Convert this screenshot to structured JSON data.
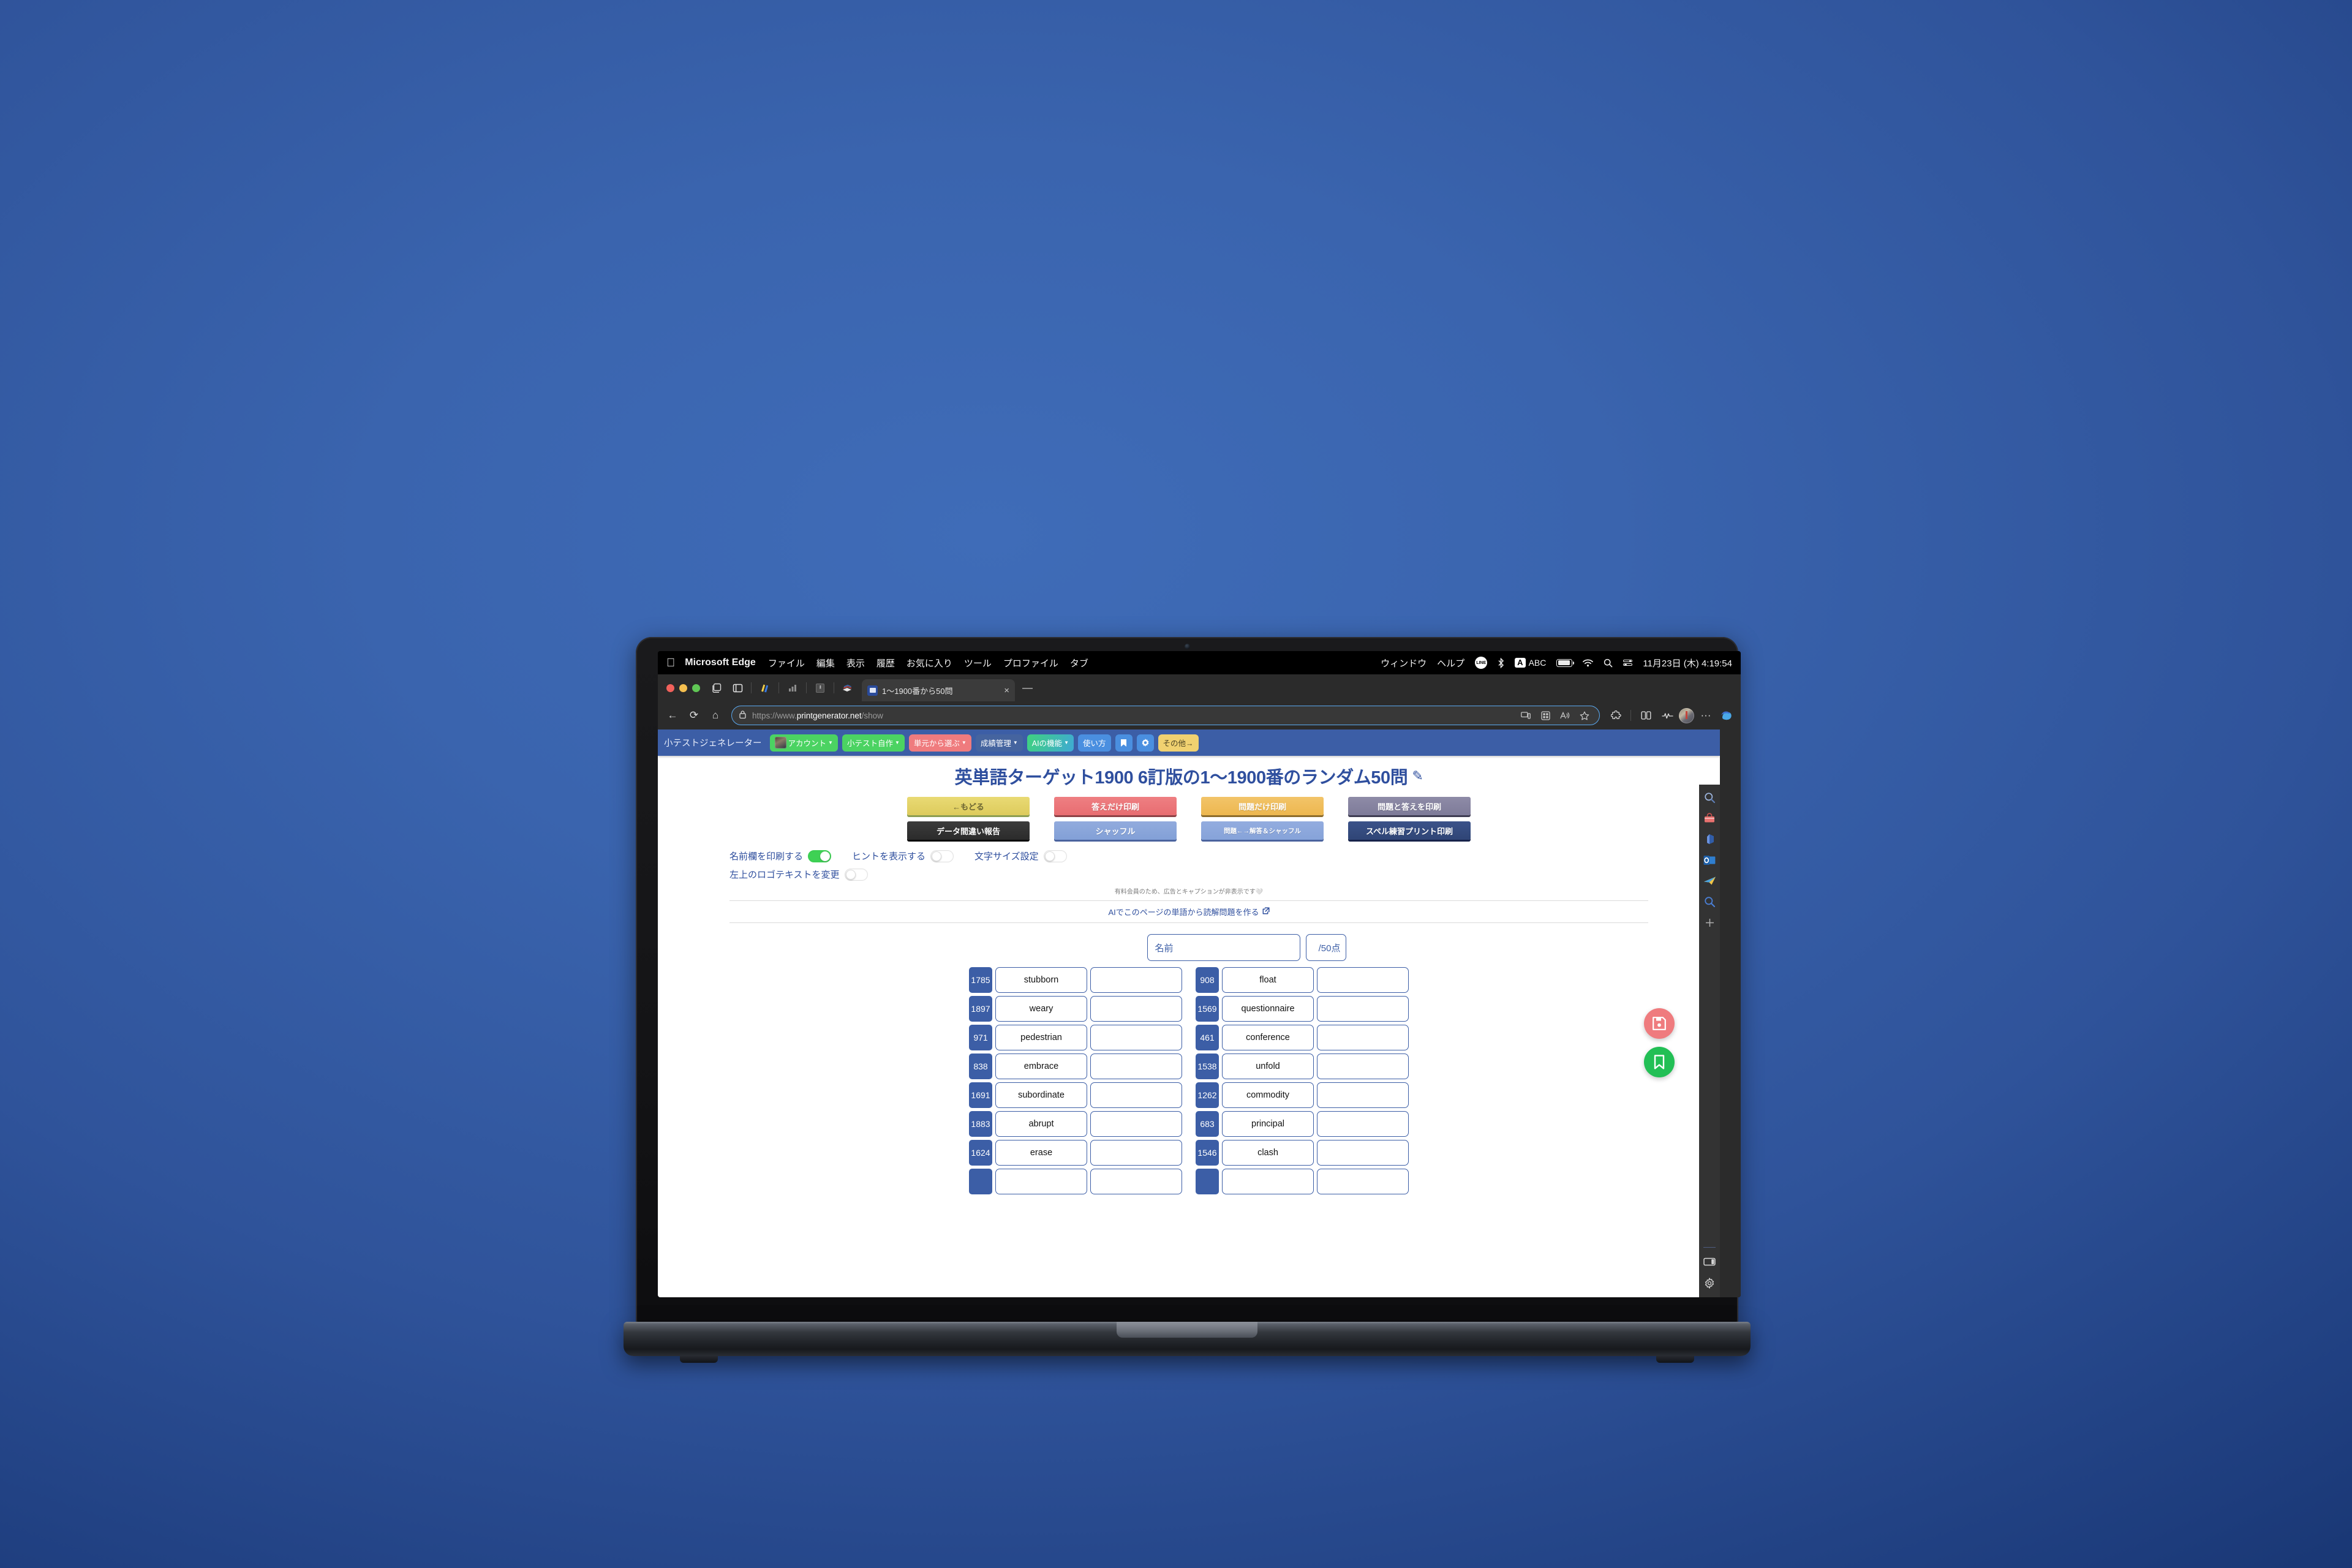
{
  "os": {
    "menubar": {
      "apple_icon": "apple-logo",
      "app_name": "Microsoft Edge",
      "menus": [
        "ファイル",
        "編集",
        "表示",
        "履歴",
        "お気に入り",
        "ツール",
        "プロファイル",
        "タブ"
      ],
      "right_menus": [
        "ウィンドウ",
        "ヘルプ"
      ],
      "status_icons": [
        "line-icon",
        "bluetooth-icon",
        "input-source-abc",
        "battery-icon",
        "wifi-icon",
        "spotlight-search-icon",
        "control-center-icon"
      ],
      "input_source_key": "A",
      "input_source_label": "ABC",
      "clock": "11月23日 (木)  4:19:54"
    }
  },
  "browser": {
    "tabstrip": {
      "traffic_lights": [
        "close",
        "minimize",
        "zoom"
      ],
      "left_icons": [
        "tab-groups-icon",
        "sidebar-toggle-icon",
        "pen-highlighter-icon",
        "bar-chart-icon",
        "reading-list-icon",
        "books-icon"
      ],
      "tab": {
        "favicon": "printgenerator-favicon",
        "title": "1〜1900番から50問",
        "close": "×"
      },
      "new_tab": "—"
    },
    "toolbar": {
      "back": "←",
      "refresh": "⟳",
      "home": "⌂",
      "lock_icon": "lock-icon",
      "url_scheme": "https://www.",
      "url_domain": "printgenerator.net",
      "url_path": "/show",
      "omnibox_icons": [
        "cast-to-device-icon",
        "collections-icon",
        "read-aloud-icon",
        "favorite-star-icon"
      ],
      "right_icons": [
        "extensions-puzzle-icon",
        "split-screen-icon",
        "browser-essentials-icon",
        "profile-avatar",
        "more-options-icon",
        "copilot-icon"
      ]
    },
    "edge_sidebar": {
      "icons": [
        "search-icon",
        "shopping-bag-icon",
        "office-icon",
        "outlook-icon",
        "telegram-plane-icon",
        "discover-search-icon",
        "add-sidebar-icon"
      ],
      "bottom_icons": [
        "sidebar-panel-icon",
        "sidebar-settings-gear-icon"
      ]
    }
  },
  "site": {
    "brand": "小テストジェネレーター",
    "nav_items": [
      {
        "label": "アカウント",
        "caret": "▼",
        "style": "np-green",
        "avatar": true
      },
      {
        "label": "小テスト自作",
        "caret": "▼",
        "style": "np-green",
        "avatar": false
      },
      {
        "label": "単元から選ぶ",
        "caret": "▼",
        "style": "np-red",
        "avatar": false
      },
      {
        "label": "成績管理",
        "caret": "▼",
        "style": "np-dim",
        "avatar": false
      },
      {
        "label": "AIの機能",
        "caret": "▼",
        "style": "np-teal",
        "avatar": false
      },
      {
        "label": "使い方",
        "caret": "",
        "style": "np-blue",
        "avatar": false
      }
    ],
    "nav_icon_buttons": [
      {
        "icon": "bookmark-icon",
        "glyph": "🔖"
      },
      {
        "icon": "gear-icon",
        "glyph": "⚙"
      }
    ],
    "nav_more": {
      "label": "その他→",
      "style": "np-yellow"
    },
    "page_title": "英単語ターゲット1900 6訂版の1〜1900番のランダム50問",
    "title_edit_icon": "pencil-icon",
    "buttons_row1": [
      {
        "label": "←もどる",
        "style": "b-yellow"
      },
      {
        "label": "答えだけ印刷",
        "style": "b-red"
      },
      {
        "label": "問題だけ印刷",
        "style": "b-orange"
      },
      {
        "label": "問題と答えを印刷",
        "style": "b-purple"
      }
    ],
    "buttons_row2": [
      {
        "label": "データ間違い報告",
        "style": "b-dark"
      },
      {
        "label": "シャッフル",
        "style": "b-lblue"
      },
      {
        "label": "問題←→解答＆シャッフル",
        "style": "b-lblue2"
      },
      {
        "label": "スペル練習プリント印刷",
        "style": "b-navy"
      }
    ],
    "toggles_row1": [
      {
        "label": "名前欄を印刷する",
        "on": true
      },
      {
        "label": "ヒントを表示する",
        "on": false
      },
      {
        "label": "文字サイズ設定",
        "on": false
      }
    ],
    "toggles_row2": [
      {
        "label": "左上のロゴテキストを変更",
        "on": false
      }
    ],
    "notice": "有料会員のため、広告とキャプションが非表示です🤍",
    "ai_link": "AIでこのページの単語から読解問題を作る",
    "ai_link_icon": "external-link-icon",
    "name_placeholder": "名前",
    "score_label": "/50点",
    "word_rows": [
      {
        "left_num": "1785",
        "left_word": "stubborn",
        "right_num": "908",
        "right_word": "float"
      },
      {
        "left_num": "1897",
        "left_word": "weary",
        "right_num": "1569",
        "right_word": "questionnaire"
      },
      {
        "left_num": "971",
        "left_word": "pedestrian",
        "right_num": "461",
        "right_word": "conference"
      },
      {
        "left_num": "838",
        "left_word": "embrace",
        "right_num": "1538",
        "right_word": "unfold"
      },
      {
        "left_num": "1691",
        "left_word": "subordinate",
        "right_num": "1262",
        "right_word": "commodity"
      },
      {
        "left_num": "1883",
        "left_word": "abrupt",
        "right_num": "683",
        "right_word": "principal"
      },
      {
        "left_num": "1624",
        "left_word": "erase",
        "right_num": "1546",
        "right_word": "clash"
      }
    ],
    "fabs": [
      {
        "name": "save-floppy-button",
        "icon": "floppy-disk-icon",
        "color": "#ef7b7e"
      },
      {
        "name": "bookmark-button",
        "icon": "bookmark-ribbon-icon",
        "color": "#22bf55"
      }
    ]
  },
  "colors": {
    "site_nav_bg": "#3c5ea6",
    "accent_blue": "#2f4f9e",
    "toggle_on": "#3ed154",
    "fab_save": "#ef7b7e",
    "fab_bookmark": "#22bf55"
  }
}
